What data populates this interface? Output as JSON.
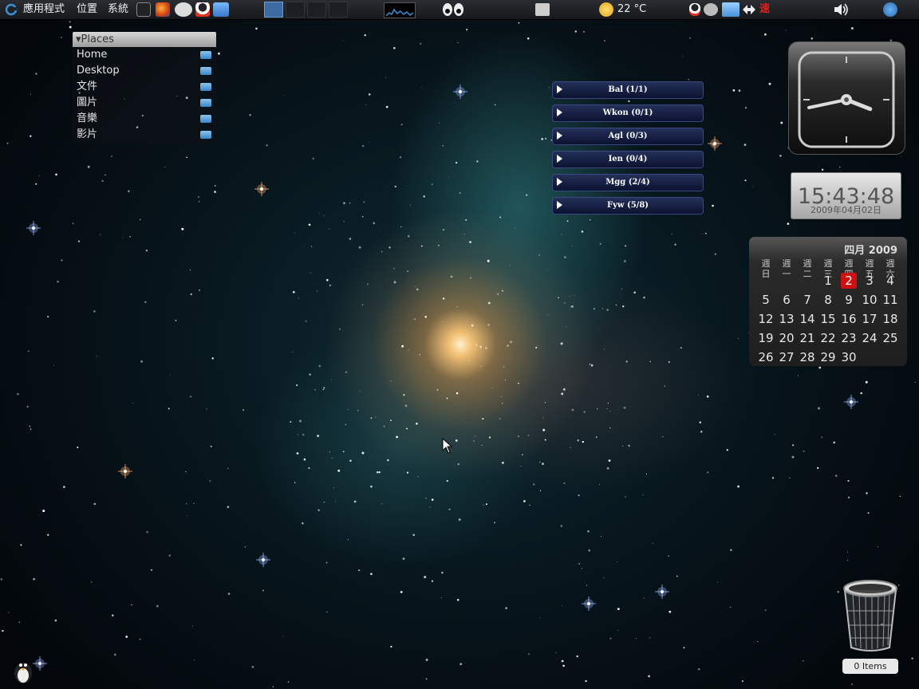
{
  "panel": {
    "menus": [
      "應用程式",
      "位置",
      "系統"
    ],
    "weather": {
      "temp": "22 °C",
      "icon": "sun-cloud-icon"
    },
    "tray_text": "速",
    "launchers": [
      "terminal-icon",
      "firefox-icon",
      "chat-icon",
      "qq-icon",
      "image-viewer-icon"
    ],
    "workspaces_count": 4,
    "active_workspace": 1
  },
  "places": {
    "title": "Places",
    "items": [
      "Home",
      "Desktop",
      "文件",
      "圖片",
      "音樂",
      "影片"
    ]
  },
  "feeds": [
    "Bal  (1/1)",
    "Wkon  (0/1)",
    "Agl  (0/3)",
    "Ien  (0/4)",
    "Mgg  (2/4)",
    "Fyw  (5/8)"
  ],
  "digital_clock": {
    "time": "15:43:48",
    "date": "2009年04月02日"
  },
  "analog_clock": {
    "hour": 3,
    "minute": 43
  },
  "calendar": {
    "title": "四月 2009",
    "weekdays": [
      "週\n日",
      "週\n一",
      "週\n二",
      "週\n三",
      "週\n四",
      "週\n五",
      "週\n六"
    ],
    "rows": [
      [
        "",
        "",
        "",
        "1",
        "2",
        "3",
        "4"
      ],
      [
        "5",
        "6",
        "7",
        "8",
        "9",
        "10",
        "11"
      ],
      [
        "12",
        "13",
        "14",
        "15",
        "16",
        "17",
        "18"
      ],
      [
        "19",
        "20",
        "21",
        "22",
        "23",
        "24",
        "25"
      ],
      [
        "26",
        "27",
        "28",
        "29",
        "30",
        "",
        ""
      ]
    ],
    "today": "2",
    "today_color": "#d01010"
  },
  "trash": {
    "label": "0 Items"
  }
}
